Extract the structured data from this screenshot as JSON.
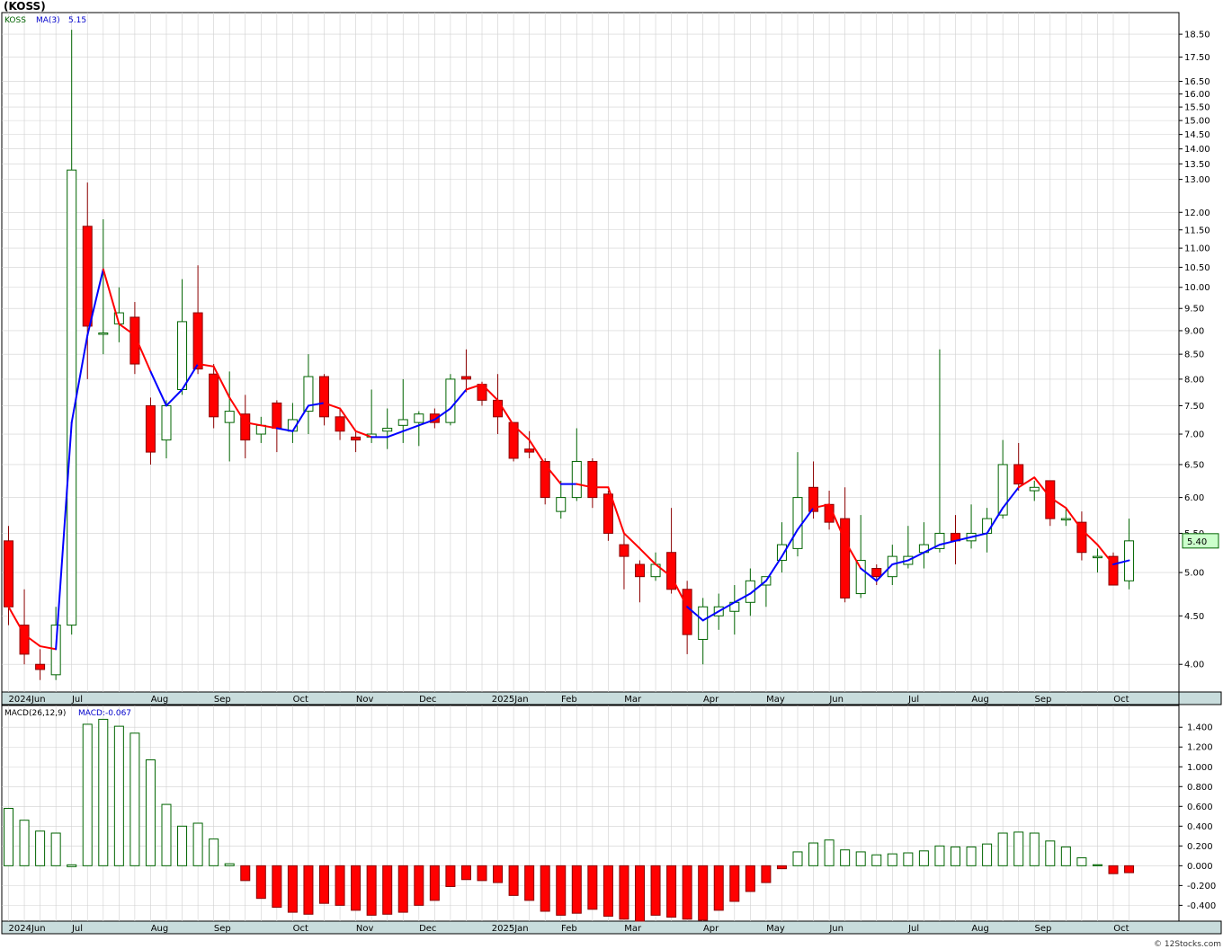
{
  "title": "(KOSS)",
  "footer": "© 12Stocks.com",
  "colors": {
    "up_fill": "#ffffff",
    "up_stroke": "#006400",
    "down_fill": "#ff0000",
    "down_stroke": "#8b0000",
    "ma_up": "#0000ff",
    "ma_down": "#ff0000",
    "macd_pos_stroke": "#006400",
    "macd_neg_fill": "#ff0000",
    "grid": "#d0d0d0",
    "axis_bar": "#c8dcdc",
    "price_box": "#ccffcc"
  },
  "chart_data": [
    {
      "type": "candlestick",
      "scale": "log",
      "legend": {
        "symbol": "KOSS",
        "ma_label": "MA(3)",
        "ma_value": "5.15"
      },
      "y_ticks": [
        {
          "v": 4.0,
          "label": "4.00"
        },
        {
          "v": 4.5,
          "label": "4.50"
        },
        {
          "v": 5.0,
          "label": "5.00"
        },
        {
          "v": 5.5,
          "label": "5.50"
        },
        {
          "v": 6.0,
          "label": "6.00"
        },
        {
          "v": 6.5,
          "label": "6.50"
        },
        {
          "v": 7.0,
          "label": "7.00"
        },
        {
          "v": 7.5,
          "label": "7.50"
        },
        {
          "v": 8.0,
          "label": "8.00"
        },
        {
          "v": 8.5,
          "label": "8.50"
        },
        {
          "v": 9.0,
          "label": "9.00"
        },
        {
          "v": 9.5,
          "label": "9.50"
        },
        {
          "v": 10.0,
          "label": "10.00"
        },
        {
          "v": 10.5,
          "label": "10.50"
        },
        {
          "v": 11.0,
          "label": "11.00"
        },
        {
          "v": 11.5,
          "label": "11.50"
        },
        {
          "v": 12.0,
          "label": "12.00"
        },
        {
          "v": 13.0,
          "label": "13.00"
        },
        {
          "v": 13.5,
          "label": "13.50"
        },
        {
          "v": 14.0,
          "label": "14.00"
        },
        {
          "v": 14.5,
          "label": "14.50"
        },
        {
          "v": 15.0,
          "label": "15.00"
        },
        {
          "v": 15.5,
          "label": "15.50"
        },
        {
          "v": 16.0,
          "label": "16.00"
        },
        {
          "v": 16.5,
          "label": "16.50"
        },
        {
          "v": 17.5,
          "label": "17.50"
        },
        {
          "v": 18.5,
          "label": "18.50"
        }
      ],
      "current_price_label": "5.40",
      "current_price": 5.4,
      "month_labels": [
        {
          "label": "2024Jun",
          "i": 0
        },
        {
          "label": "Jul",
          "i": 4.3
        },
        {
          "label": "Aug",
          "i": 9.3
        },
        {
          "label": "Sep",
          "i": 13.3
        },
        {
          "label": "Oct",
          "i": 18.3
        },
        {
          "label": "Nov",
          "i": 22.3
        },
        {
          "label": "Dec",
          "i": 26.3
        },
        {
          "label": "2025Jan",
          "i": 30.9
        },
        {
          "label": "Feb",
          "i": 35.3
        },
        {
          "label": "Mar",
          "i": 39.3
        },
        {
          "label": "Apr",
          "i": 44.3
        },
        {
          "label": "May",
          "i": 48.3
        },
        {
          "label": "Jun",
          "i": 52.3
        },
        {
          "label": "Jul",
          "i": 57.3
        },
        {
          "label": "Aug",
          "i": 61.3
        },
        {
          "label": "Sep",
          "i": 65.3
        },
        {
          "label": "Oct",
          "i": 70.3
        }
      ],
      "candles": [
        {
          "o": 5.4,
          "h": 5.6,
          "l": 4.4,
          "c": 4.6
        },
        {
          "o": 4.4,
          "h": 4.8,
          "l": 4.0,
          "c": 4.1
        },
        {
          "o": 4.0,
          "h": 4.15,
          "l": 3.85,
          "c": 3.95
        },
        {
          "o": 3.9,
          "h": 4.6,
          "l": 3.85,
          "c": 4.4
        },
        {
          "o": 4.4,
          "h": 18.7,
          "l": 4.3,
          "c": 13.3
        },
        {
          "o": 11.6,
          "h": 12.9,
          "l": 8.0,
          "c": 9.1
        },
        {
          "o": 8.95,
          "h": 11.8,
          "l": 8.5,
          "c": 8.95
        },
        {
          "o": 9.15,
          "h": 10.0,
          "l": 8.75,
          "c": 9.4
        },
        {
          "o": 9.3,
          "h": 9.65,
          "l": 8.1,
          "c": 8.3
        },
        {
          "o": 7.5,
          "h": 7.65,
          "l": 6.5,
          "c": 6.7
        },
        {
          "o": 6.9,
          "h": 7.6,
          "l": 6.6,
          "c": 7.5
        },
        {
          "o": 7.8,
          "h": 10.2,
          "l": 7.7,
          "c": 9.2
        },
        {
          "o": 9.4,
          "h": 10.55,
          "l": 8.1,
          "c": 8.2
        },
        {
          "o": 8.1,
          "h": 8.3,
          "l": 7.1,
          "c": 7.3
        },
        {
          "o": 7.2,
          "h": 8.15,
          "l": 6.55,
          "c": 7.4
        },
        {
          "o": 7.35,
          "h": 7.7,
          "l": 6.6,
          "c": 6.9
        },
        {
          "o": 7.0,
          "h": 7.3,
          "l": 6.85,
          "c": 7.15
        },
        {
          "o": 7.55,
          "h": 7.6,
          "l": 6.7,
          "c": 7.1
        },
        {
          "o": 7.05,
          "h": 7.55,
          "l": 6.85,
          "c": 7.25
        },
        {
          "o": 7.4,
          "h": 8.5,
          "l": 7.0,
          "c": 8.05
        },
        {
          "o": 8.05,
          "h": 8.1,
          "l": 7.15,
          "c": 7.3
        },
        {
          "o": 7.3,
          "h": 7.45,
          "l": 6.9,
          "c": 7.05
        },
        {
          "o": 6.95,
          "h": 7.05,
          "l": 6.7,
          "c": 6.9
        },
        {
          "o": 6.95,
          "h": 7.8,
          "l": 6.85,
          "c": 7.0
        },
        {
          "o": 7.05,
          "h": 7.45,
          "l": 6.75,
          "c": 7.1
        },
        {
          "o": 7.15,
          "h": 8.0,
          "l": 6.85,
          "c": 7.25
        },
        {
          "o": 7.2,
          "h": 7.4,
          "l": 6.8,
          "c": 7.35
        },
        {
          "o": 7.35,
          "h": 7.45,
          "l": 7.1,
          "c": 7.2
        },
        {
          "o": 7.2,
          "h": 8.1,
          "l": 7.15,
          "c": 8.0
        },
        {
          "o": 8.05,
          "h": 8.6,
          "l": 7.75,
          "c": 8.0
        },
        {
          "o": 7.9,
          "h": 7.95,
          "l": 7.5,
          "c": 7.6
        },
        {
          "o": 7.6,
          "h": 8.1,
          "l": 7.0,
          "c": 7.3
        },
        {
          "o": 7.2,
          "h": 7.2,
          "l": 6.55,
          "c": 6.6
        },
        {
          "o": 6.75,
          "h": 7.05,
          "l": 6.6,
          "c": 6.7
        },
        {
          "o": 6.55,
          "h": 6.6,
          "l": 5.9,
          "c": 6.0
        },
        {
          "o": 5.8,
          "h": 6.25,
          "l": 5.7,
          "c": 6.0
        },
        {
          "o": 6.0,
          "h": 7.1,
          "l": 5.95,
          "c": 6.55
        },
        {
          "o": 6.55,
          "h": 6.6,
          "l": 5.85,
          "c": 6.0
        },
        {
          "o": 6.05,
          "h": 6.1,
          "l": 5.4,
          "c": 5.5
        },
        {
          "o": 5.35,
          "h": 5.5,
          "l": 4.8,
          "c": 5.2
        },
        {
          "o": 5.1,
          "h": 5.15,
          "l": 4.65,
          "c": 4.95
        },
        {
          "o": 4.95,
          "h": 5.25,
          "l": 4.9,
          "c": 5.1
        },
        {
          "o": 5.25,
          "h": 5.85,
          "l": 4.75,
          "c": 4.8
        },
        {
          "o": 4.8,
          "h": 4.9,
          "l": 4.1,
          "c": 4.3
        },
        {
          "o": 4.25,
          "h": 4.7,
          "l": 4.0,
          "c": 4.6
        },
        {
          "o": 4.5,
          "h": 4.75,
          "l": 4.35,
          "c": 4.6
        },
        {
          "o": 4.55,
          "h": 4.85,
          "l": 4.3,
          "c": 4.65
        },
        {
          "o": 4.65,
          "h": 5.05,
          "l": 4.5,
          "c": 4.9
        },
        {
          "o": 4.85,
          "h": 4.95,
          "l": 4.6,
          "c": 4.95
        },
        {
          "o": 5.15,
          "h": 5.65,
          "l": 5.0,
          "c": 5.35
        },
        {
          "o": 5.3,
          "h": 6.7,
          "l": 5.2,
          "c": 6.0
        },
        {
          "o": 6.15,
          "h": 6.55,
          "l": 5.7,
          "c": 5.8
        },
        {
          "o": 5.9,
          "h": 6.1,
          "l": 5.55,
          "c": 5.65
        },
        {
          "o": 5.7,
          "h": 6.15,
          "l": 4.65,
          "c": 4.7
        },
        {
          "o": 4.75,
          "h": 5.75,
          "l": 4.7,
          "c": 5.15
        },
        {
          "o": 5.05,
          "h": 5.1,
          "l": 4.85,
          "c": 4.95
        },
        {
          "o": 4.95,
          "h": 5.35,
          "l": 4.85,
          "c": 5.2
        },
        {
          "o": 5.1,
          "h": 5.6,
          "l": 5.05,
          "c": 5.2
        },
        {
          "o": 5.25,
          "h": 5.65,
          "l": 5.05,
          "c": 5.35
        },
        {
          "o": 5.3,
          "h": 8.6,
          "l": 5.25,
          "c": 5.5
        },
        {
          "o": 5.5,
          "h": 5.75,
          "l": 5.1,
          "c": 5.4
        },
        {
          "o": 5.4,
          "h": 5.9,
          "l": 5.3,
          "c": 5.5
        },
        {
          "o": 5.5,
          "h": 5.85,
          "l": 5.25,
          "c": 5.7
        },
        {
          "o": 5.75,
          "h": 6.9,
          "l": 5.7,
          "c": 6.5
        },
        {
          "o": 6.5,
          "h": 6.85,
          "l": 6.1,
          "c": 6.2
        },
        {
          "o": 6.1,
          "h": 6.25,
          "l": 5.95,
          "c": 6.15
        },
        {
          "o": 6.25,
          "h": 6.25,
          "l": 5.6,
          "c": 5.7
        },
        {
          "o": 5.7,
          "h": 5.85,
          "l": 5.6,
          "c": 5.7
        },
        {
          "o": 5.65,
          "h": 5.8,
          "l": 5.15,
          "c": 5.25
        },
        {
          "o": 5.2,
          "h": 5.3,
          "l": 5.0,
          "c": 5.2
        },
        {
          "o": 5.2,
          "h": 5.25,
          "l": 4.85,
          "c": 4.85
        },
        {
          "o": 4.9,
          "h": 5.7,
          "l": 4.8,
          "c": 5.4
        }
      ],
      "ma": [
        4.6,
        4.3,
        4.18,
        4.15,
        7.2,
        8.9,
        10.45,
        9.15,
        8.9,
        8.15,
        7.5,
        7.8,
        8.3,
        8.25,
        7.65,
        7.2,
        7.15,
        7.1,
        7.05,
        7.5,
        7.55,
        7.45,
        7.05,
        6.95,
        6.95,
        7.05,
        7.15,
        7.25,
        7.45,
        7.8,
        7.9,
        7.6,
        7.15,
        6.9,
        6.5,
        6.2,
        6.2,
        6.15,
        6.15,
        5.5,
        5.3,
        5.1,
        4.95,
        4.6,
        4.45,
        4.55,
        4.65,
        4.75,
        4.9,
        5.2,
        5.55,
        5.85,
        5.9,
        5.4,
        5.05,
        4.9,
        5.1,
        5.15,
        5.25,
        5.35,
        5.4,
        5.45,
        5.5,
        5.85,
        6.15,
        6.3,
        6.0,
        5.85,
        5.55,
        5.35,
        5.1,
        5.15
      ],
      "ma_up": [
        true,
        false,
        false,
        false,
        true,
        true,
        true,
        false,
        false,
        false,
        true,
        true,
        true,
        false,
        false,
        false,
        false,
        false,
        true,
        true,
        true,
        false,
        false,
        false,
        true,
        true,
        true,
        true,
        true,
        true,
        false,
        false,
        false,
        false,
        false,
        false,
        true,
        false,
        false,
        false,
        false,
        false,
        false,
        false,
        true,
        true,
        true,
        true,
        true,
        true,
        true,
        true,
        false,
        false,
        false,
        true,
        true,
        true,
        true,
        true,
        true,
        true,
        true,
        true,
        true,
        false,
        false,
        false,
        false,
        false,
        false,
        true
      ]
    },
    {
      "type": "bar",
      "legend": {
        "label": "MACD(26,12,9)",
        "value_label": "MACD:-0.067"
      },
      "y_ticks": [
        {
          "v": 1.4,
          "label": "1.400"
        },
        {
          "v": 1.2,
          "label": "1.200"
        },
        {
          "v": 1.0,
          "label": "1.000"
        },
        {
          "v": 0.8,
          "label": "0.800"
        },
        {
          "v": 0.6,
          "label": "0.600"
        },
        {
          "v": 0.4,
          "label": "0.400"
        },
        {
          "v": 0.2,
          "label": "0.200"
        },
        {
          "v": 0.0,
          "label": "0.000"
        },
        {
          "v": -0.2,
          "label": "-0.200"
        },
        {
          "v": -0.4,
          "label": "-0.400"
        }
      ],
      "ylim": [
        -0.56,
        1.62
      ],
      "values": [
        0.58,
        0.46,
        0.35,
        0.33,
        0.0,
        1.43,
        1.48,
        1.41,
        1.34,
        1.07,
        0.62,
        0.4,
        0.43,
        0.27,
        0.02,
        -0.15,
        -0.33,
        -0.42,
        -0.47,
        -0.49,
        -0.38,
        -0.4,
        -0.45,
        -0.5,
        -0.49,
        -0.47,
        -0.4,
        -0.35,
        -0.21,
        -0.14,
        -0.15,
        -0.17,
        -0.3,
        -0.35,
        -0.46,
        -0.5,
        -0.48,
        -0.44,
        -0.51,
        -0.54,
        -0.56,
        -0.5,
        -0.52,
        -0.54,
        -0.55,
        -0.45,
        -0.36,
        -0.26,
        -0.17,
        -0.03,
        0.14,
        0.23,
        0.26,
        0.16,
        0.14,
        0.11,
        0.12,
        0.13,
        0.15,
        0.2,
        0.19,
        0.19,
        0.22,
        0.33,
        0.34,
        0.33,
        0.25,
        0.19,
        0.08,
        0.01,
        -0.08,
        -0.07
      ]
    }
  ]
}
